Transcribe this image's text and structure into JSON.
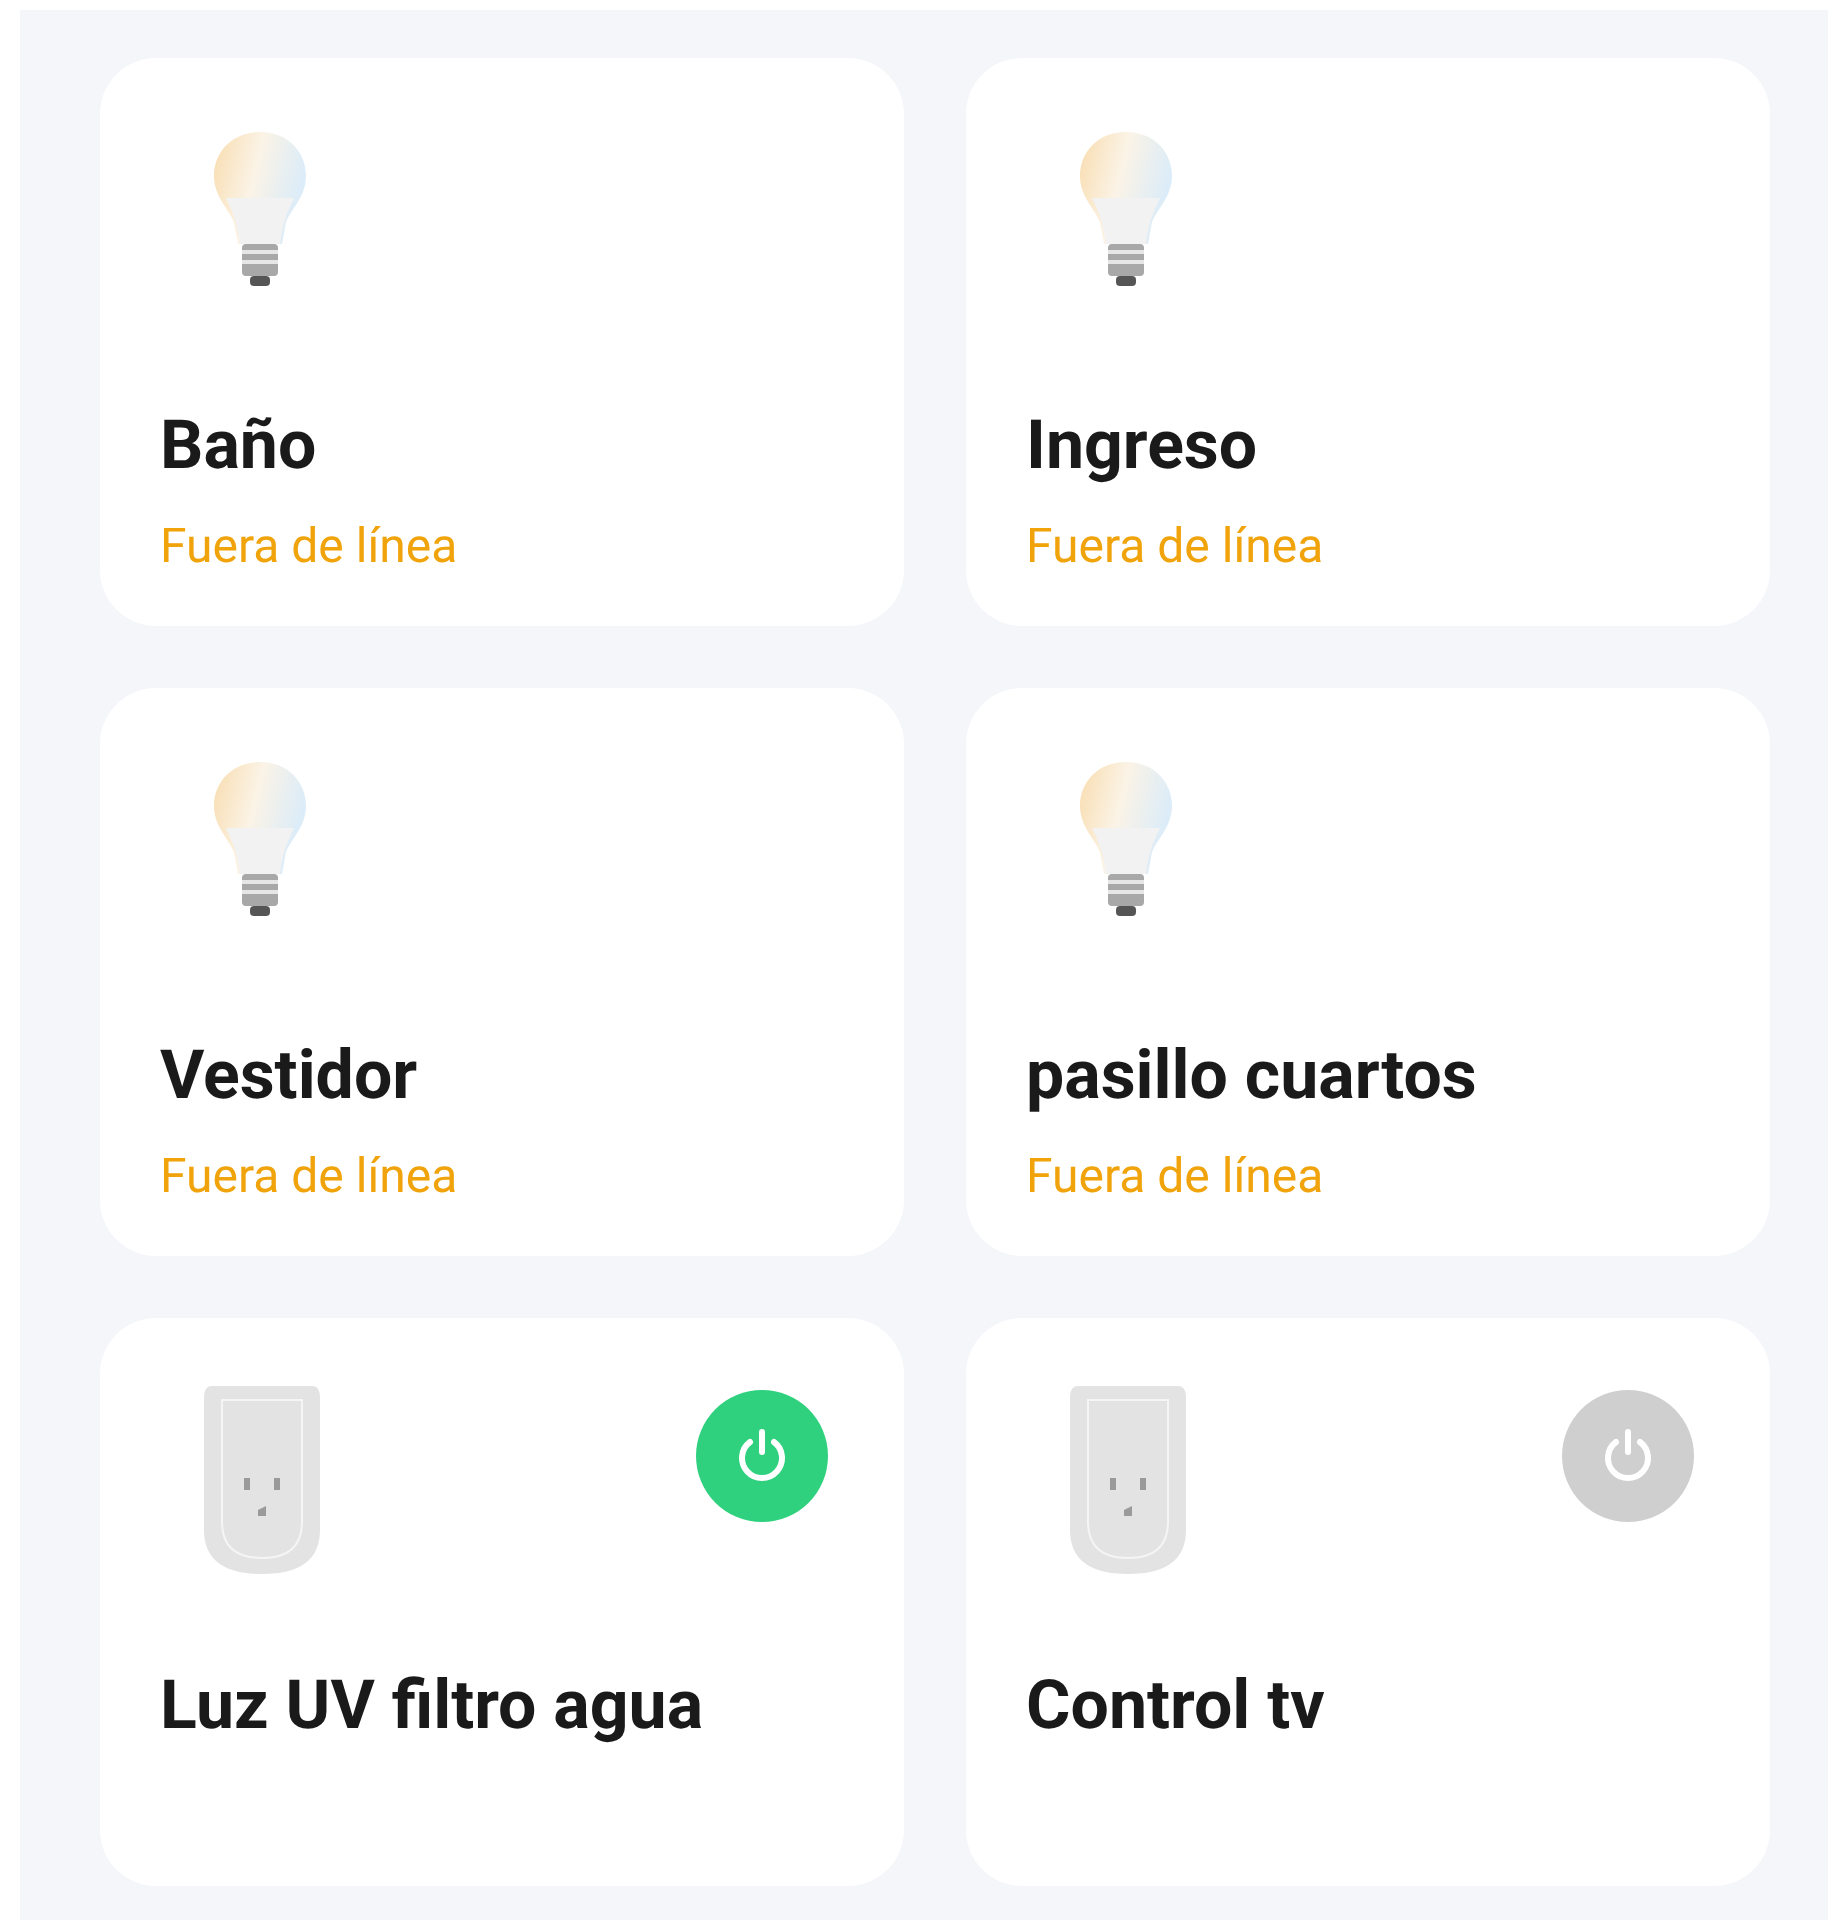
{
  "devices": [
    {
      "kind": "bulb",
      "name": "Baño",
      "status": "Fuera de línea"
    },
    {
      "kind": "bulb",
      "name": "Ingreso",
      "status": "Fuera de línea"
    },
    {
      "kind": "bulb",
      "name": "Vestidor",
      "status": "Fuera de línea"
    },
    {
      "kind": "bulb",
      "name": "pasillo cuartos",
      "status": "Fuera de línea"
    },
    {
      "kind": "plug",
      "name": "Luz UV filtro agua",
      "on": true
    },
    {
      "kind": "plug",
      "name": "Control tv",
      "on": false
    }
  ]
}
